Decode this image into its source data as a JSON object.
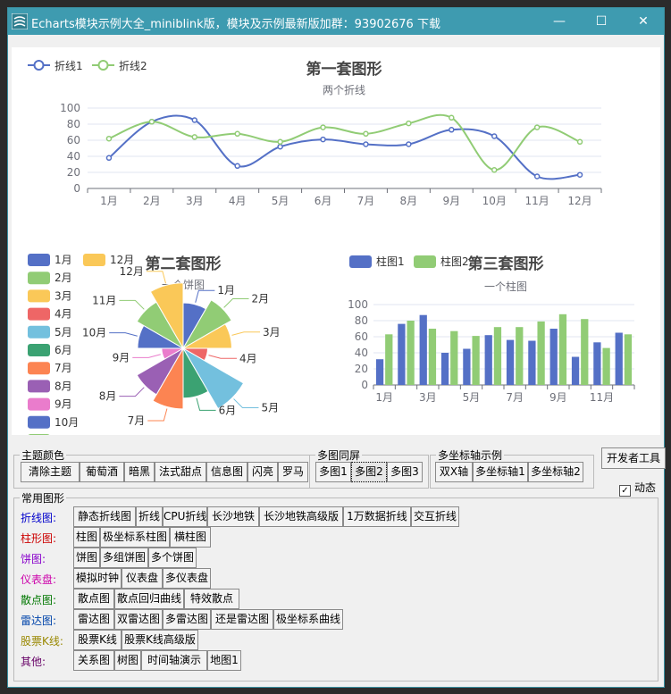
{
  "window": {
    "title": "Echarts模块示例大全_miniblink版，模块及示例最新版加群：93902676 下载",
    "controls": {
      "minimize": "—",
      "maximize": "☐",
      "close": "✕"
    }
  },
  "charts": {
    "line": {
      "title": "第一套图形",
      "subtitle": "两个折线",
      "legend": [
        "折线1",
        "折线2"
      ],
      "colors": [
        "#5470c6",
        "#91cc75"
      ],
      "ylim": [
        0,
        100
      ],
      "yticks": [
        "0",
        "20",
        "40",
        "60",
        "80",
        "100"
      ],
      "categories": [
        "1月",
        "2月",
        "3月",
        "4月",
        "5月",
        "6月",
        "7月",
        "8月",
        "9月",
        "10月",
        "11月",
        "12月"
      ],
      "series": [
        {
          "name": "折线1",
          "values": [
            38,
            83,
            85,
            28,
            52,
            61,
            55,
            55,
            73,
            65,
            15,
            17
          ]
        },
        {
          "name": "折线2",
          "values": [
            62,
            83,
            64,
            68,
            58,
            76,
            68,
            81,
            88,
            23,
            76,
            58
          ]
        }
      ]
    },
    "pie": {
      "title": "第二套图形",
      "subtitle": "一个饼图",
      "legend": [
        "1月",
        "2月",
        "3月",
        "4月",
        "5月",
        "6月",
        "7月",
        "8月",
        "9月",
        "10月",
        "11月",
        "12月"
      ],
      "colors": [
        "#5470c6",
        "#91cc75",
        "#fac858",
        "#ee6666",
        "#73c0de",
        "#3ba272",
        "#fc8452",
        "#9a60b4",
        "#ea7ccc",
        "#5470c6",
        "#91cc75",
        "#fac858"
      ],
      "values": [
        55,
        72,
        60,
        20,
        95,
        62,
        80,
        68,
        15,
        55,
        68,
        88
      ]
    },
    "bar": {
      "title": "第三套图形",
      "subtitle": "一个柱图",
      "legend": [
        "柱图1",
        "柱图2"
      ],
      "colors": [
        "#5470c6",
        "#91cc75"
      ],
      "ylim": [
        0,
        100
      ],
      "yticks": [
        "0",
        "20",
        "40",
        "60",
        "80",
        "100"
      ],
      "categories": [
        "1月",
        "2月",
        "3月",
        "4月",
        "5月",
        "6月",
        "7月",
        "8月",
        "9月",
        "10月",
        "11月",
        "12月"
      ],
      "xticks": [
        "1月",
        "3月",
        "5月",
        "7月",
        "9月",
        "11月"
      ],
      "series": [
        {
          "name": "柱图1",
          "values": [
            32,
            76,
            87,
            40,
            45,
            62,
            56,
            55,
            70,
            35,
            53,
            65
          ]
        },
        {
          "name": "柱图2",
          "values": [
            63,
            80,
            70,
            67,
            61,
            72,
            72,
            79,
            88,
            82,
            46,
            63
          ]
        }
      ]
    }
  },
  "theme": {
    "legend": "主题颜色",
    "buttons": [
      "清除主题",
      "葡萄酒",
      "暗黑",
      "法式甜点",
      "信息图",
      "闪亮",
      "罗马"
    ]
  },
  "multi": {
    "legend": "多图同屏",
    "buttons": [
      "多图1",
      "多图2",
      "多图3"
    ]
  },
  "axis": {
    "legend": "多坐标轴示例",
    "buttons": [
      "双X轴",
      "多坐标轴1",
      "多坐标轴2"
    ]
  },
  "devtools": {
    "label": "开发者工具"
  },
  "dynamic": {
    "label": "动态",
    "checked_mark": "✓"
  },
  "common": {
    "legend": "常用图形",
    "categories": [
      {
        "label": "折线图:",
        "color": "#0000cc",
        "buttons": [
          "静态折线图",
          "折线",
          "CPU折线",
          "长沙地铁",
          "长沙地铁高级版",
          "1万数据折线",
          "交互折线"
        ]
      },
      {
        "label": "柱形图:",
        "color": "#cc0000",
        "buttons": [
          "柱图",
          "极坐标系柱图",
          "横柱图"
        ]
      },
      {
        "label": "饼图:",
        "color": "#8800cc",
        "buttons": [
          "饼图",
          "多组饼图",
          "多个饼图"
        ]
      },
      {
        "label": "仪表盘:",
        "color": "#cc00aa",
        "buttons": [
          "模拟时钟",
          "仪表盘",
          "多仪表盘"
        ]
      },
      {
        "label": "散点图:",
        "color": "#007700",
        "buttons": [
          "散点图",
          "散点回归曲线",
          "特效散点"
        ]
      },
      {
        "label": "雷达图:",
        "color": "#0044aa",
        "buttons": [
          "雷达图",
          "双雷达图",
          "多雷达图",
          "还是雷达图",
          "极坐标系曲线"
        ]
      },
      {
        "label": "股票K线:",
        "color": "#998800",
        "buttons": [
          "股票K线",
          "股票K线高级版"
        ]
      },
      {
        "label": "其他:",
        "color": "#660066",
        "buttons": [
          "关系图",
          "树图",
          "时间轴演示",
          "地图1"
        ]
      }
    ]
  }
}
